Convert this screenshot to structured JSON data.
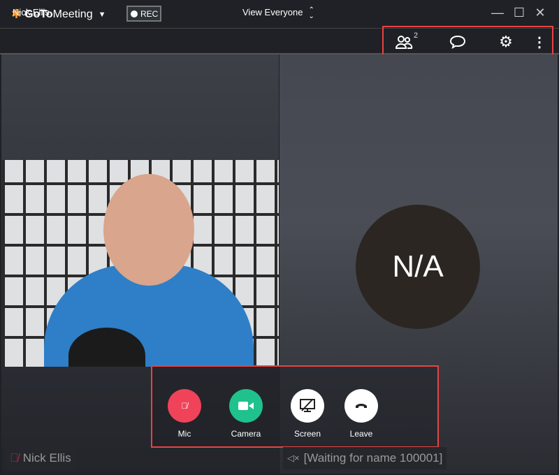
{
  "app": {
    "brand_bold": "GoTo",
    "brand_light": "Meeting",
    "rec_label": "REC"
  },
  "header": {
    "presenter_name": "Nick Ellis",
    "view_label": "View Everyone",
    "participants_count": "2"
  },
  "main": {
    "avatar_initials": "N/A",
    "local_name": "Nick Ellis",
    "remote_name": "[Waiting for name 100001]"
  },
  "controls": [
    {
      "label": "Mic",
      "color": "#f0435a"
    },
    {
      "label": "Camera",
      "color": "#1fc28c"
    },
    {
      "label": "Screen",
      "color": "#ffffff"
    },
    {
      "label": "Leave",
      "color": "#ffffff"
    }
  ]
}
